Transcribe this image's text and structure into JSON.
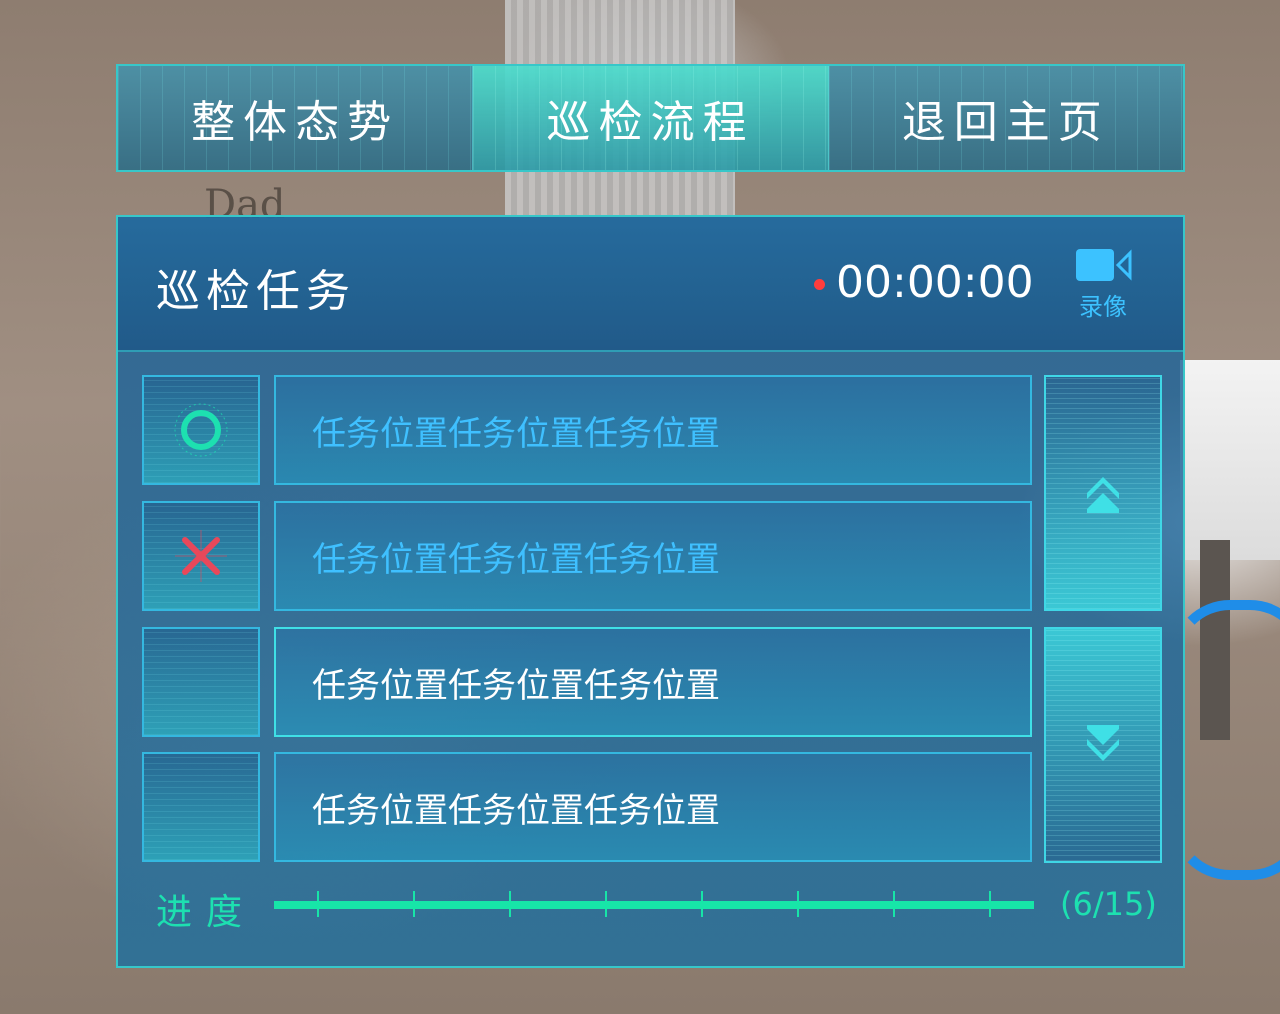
{
  "nav": {
    "tabs": [
      {
        "label": "整体态势",
        "active": false
      },
      {
        "label": "巡检流程",
        "active": true
      },
      {
        "label": "退回主页",
        "active": false
      }
    ]
  },
  "panel": {
    "title": "巡检任务",
    "timer": "00:00:00",
    "record_label": "录像",
    "rows": [
      {
        "status": "ok",
        "status_icon": "circle-ok-icon",
        "text": "任务位置任务位置任务位置"
      },
      {
        "status": "fail",
        "status_icon": "cross-fail-icon",
        "text": "任务位置任务位置任务位置"
      },
      {
        "status": "current",
        "status_icon": "",
        "text": "任务位置任务位置任务位置"
      },
      {
        "status": "pending",
        "status_icon": "",
        "text": "任务位置任务位置任务位置"
      }
    ],
    "progress": {
      "label": "进度",
      "count_text": "(6/15)",
      "value": 1.0
    }
  },
  "colors": {
    "accent": "#37c7c9",
    "progress": "#17e5a8",
    "ok": "#1de0b0",
    "fail": "#e8485a",
    "record": "#3cc2ff"
  }
}
